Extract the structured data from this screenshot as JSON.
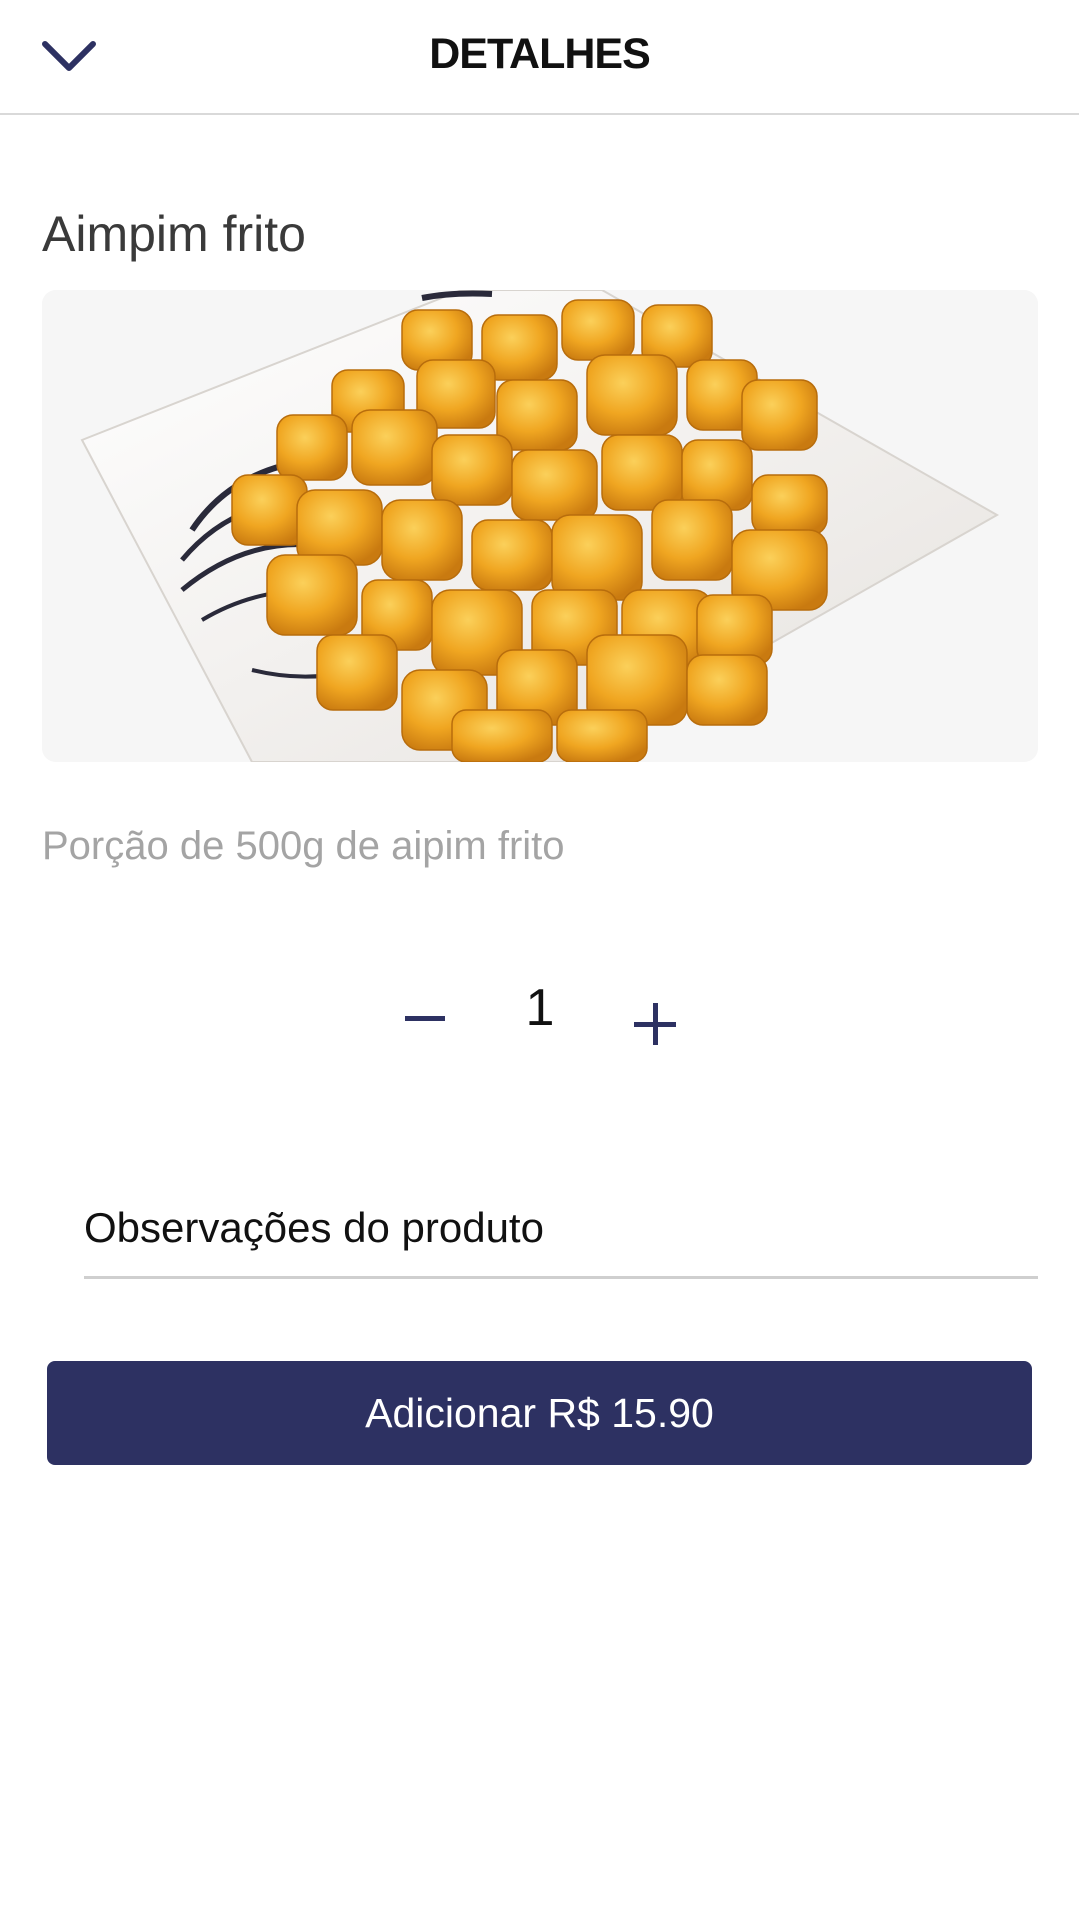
{
  "header": {
    "back_icon": "chevron-down-icon",
    "title": "DETALHES"
  },
  "product": {
    "name": "Aimpim frito",
    "image_alt": "Aimpim frito",
    "description": "Porção de 500g de aipim frito"
  },
  "quantity": {
    "value": "1",
    "minus_icon": "minus-icon",
    "plus_icon": "plus-icon"
  },
  "notes": {
    "placeholder": "Observações do produto",
    "value": ""
  },
  "add_button": {
    "label": "Adicionar R$ 15.90"
  },
  "colors": {
    "accent": "#2d3162",
    "description_text": "#a4a4a4",
    "header_border": "#d9d9d9"
  }
}
